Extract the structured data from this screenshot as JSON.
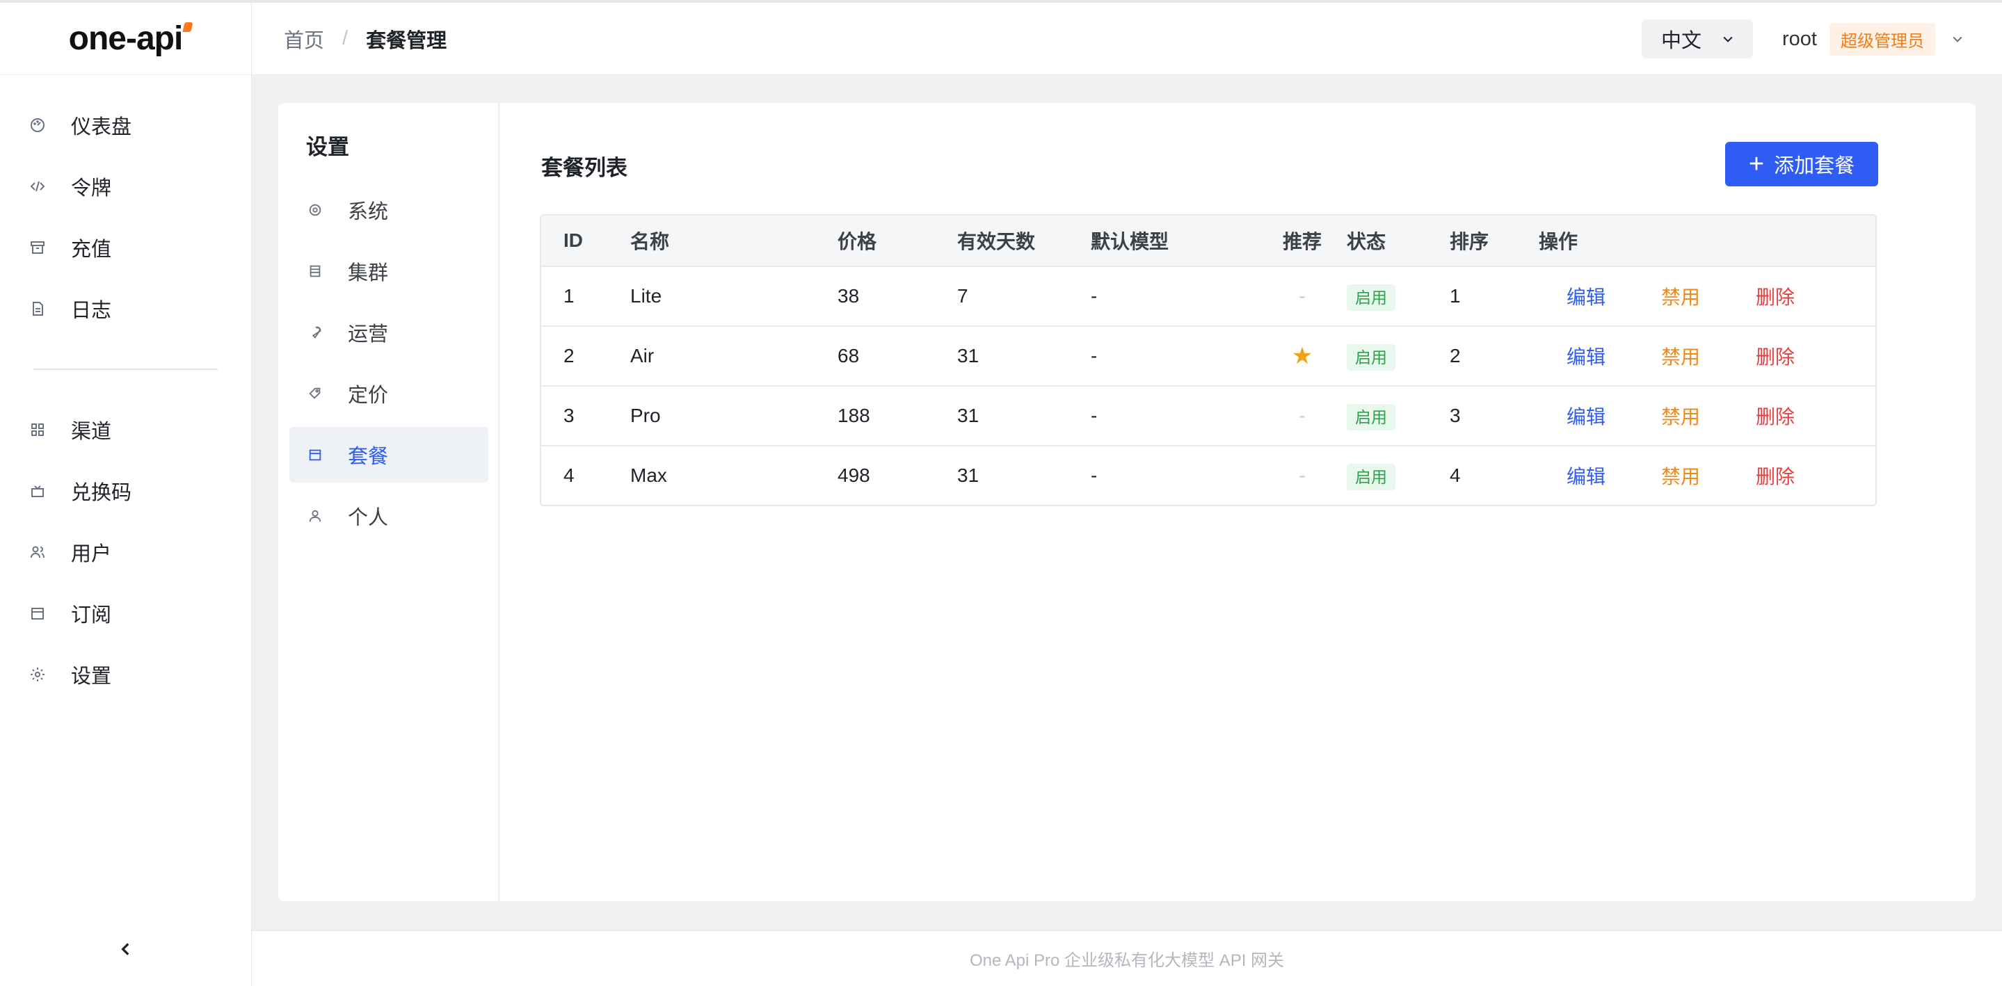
{
  "app": {
    "logo_text": "one-api"
  },
  "sidebar": {
    "items": [
      {
        "label": "仪表盘",
        "icon": "dashboard-icon"
      },
      {
        "label": "令牌",
        "icon": "code-icon"
      },
      {
        "label": "充值",
        "icon": "archive-icon"
      },
      {
        "label": "日志",
        "icon": "document-icon"
      }
    ],
    "items2": [
      {
        "label": "渠道",
        "icon": "grid-icon"
      },
      {
        "label": "兑换码",
        "icon": "gift-icon"
      },
      {
        "label": "用户",
        "icon": "users-icon"
      },
      {
        "label": "订阅",
        "icon": "calendar-icon"
      },
      {
        "label": "设置",
        "icon": "gear-icon"
      }
    ],
    "collapse_icon": "chevron-left-icon"
  },
  "header": {
    "breadcrumb_home": "首页",
    "breadcrumb_sep": "/",
    "breadcrumb_current": "套餐管理",
    "language": "中文",
    "user_name": "root",
    "user_role": "超级管理员"
  },
  "settings": {
    "title": "设置",
    "items": [
      {
        "label": "系统",
        "icon": "gear-icon",
        "active": false
      },
      {
        "label": "集群",
        "icon": "server-icon",
        "active": false
      },
      {
        "label": "运营",
        "icon": "wrench-icon",
        "active": false
      },
      {
        "label": "定价",
        "icon": "tag-icon",
        "active": false
      },
      {
        "label": "套餐",
        "icon": "calendar-icon",
        "active": true
      },
      {
        "label": "个人",
        "icon": "user-icon",
        "active": false
      }
    ]
  },
  "plans": {
    "title": "套餐列表",
    "add_label": "添加套餐",
    "columns": {
      "id": "ID",
      "name": "名称",
      "price": "价格",
      "days": "有效天数",
      "model": "默认模型",
      "rec": "推荐",
      "status": "状态",
      "order": "排序",
      "ops": "操作"
    },
    "rows": [
      {
        "id": "1",
        "name": "Lite",
        "price": "38",
        "days": "7",
        "model": "-",
        "rec": "-",
        "status": "启用",
        "order": "1",
        "edit": "编辑",
        "disable": "禁用",
        "delete": "删除"
      },
      {
        "id": "2",
        "name": "Air",
        "price": "68",
        "days": "31",
        "model": "-",
        "rec": "★",
        "status": "启用",
        "order": "2",
        "edit": "编辑",
        "disable": "禁用",
        "delete": "删除"
      },
      {
        "id": "3",
        "name": "Pro",
        "price": "188",
        "days": "31",
        "model": "-",
        "rec": "-",
        "status": "启用",
        "order": "3",
        "edit": "编辑",
        "disable": "禁用",
        "delete": "删除"
      },
      {
        "id": "4",
        "name": "Max",
        "price": "498",
        "days": "31",
        "model": "-",
        "rec": "-",
        "status": "启用",
        "order": "4",
        "edit": "编辑",
        "disable": "禁用",
        "delete": "删除"
      }
    ]
  },
  "footer": {
    "text": "One Api Pro 企业级私有化大模型 API 网关"
  },
  "colors": {
    "accent": "#2f5cf2",
    "warning": "#f08a1a",
    "danger": "#e53e3e",
    "success": "#2ea14b",
    "star": "#f0a31a"
  }
}
